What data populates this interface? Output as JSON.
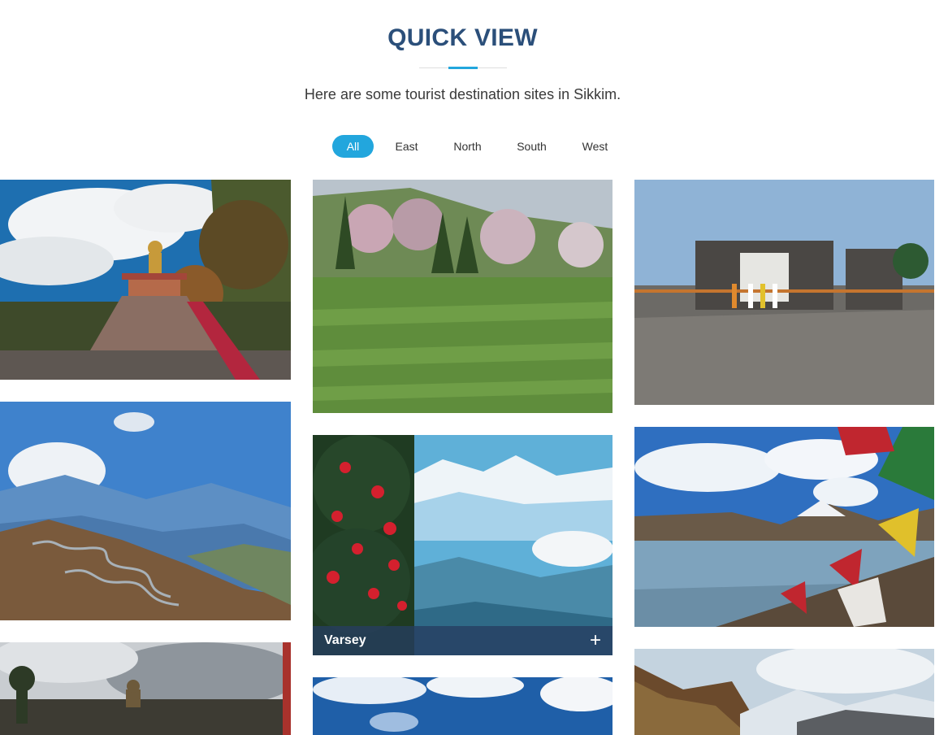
{
  "section": {
    "title": "QUICK VIEW",
    "subtitle": "Here are some tourist destination sites in Sikkim."
  },
  "filters": [
    {
      "label": "All",
      "active": true
    },
    {
      "label": "East",
      "active": false
    },
    {
      "label": "North",
      "active": false
    },
    {
      "label": "South",
      "active": false
    },
    {
      "label": "West",
      "active": false
    }
  ],
  "gallery": {
    "hover_caption": "Varsey",
    "expand_icon": "plus-icon"
  },
  "colors": {
    "title": "#2b4f7a",
    "accent": "#22a6dd",
    "caption_overlay": "#263e60"
  }
}
